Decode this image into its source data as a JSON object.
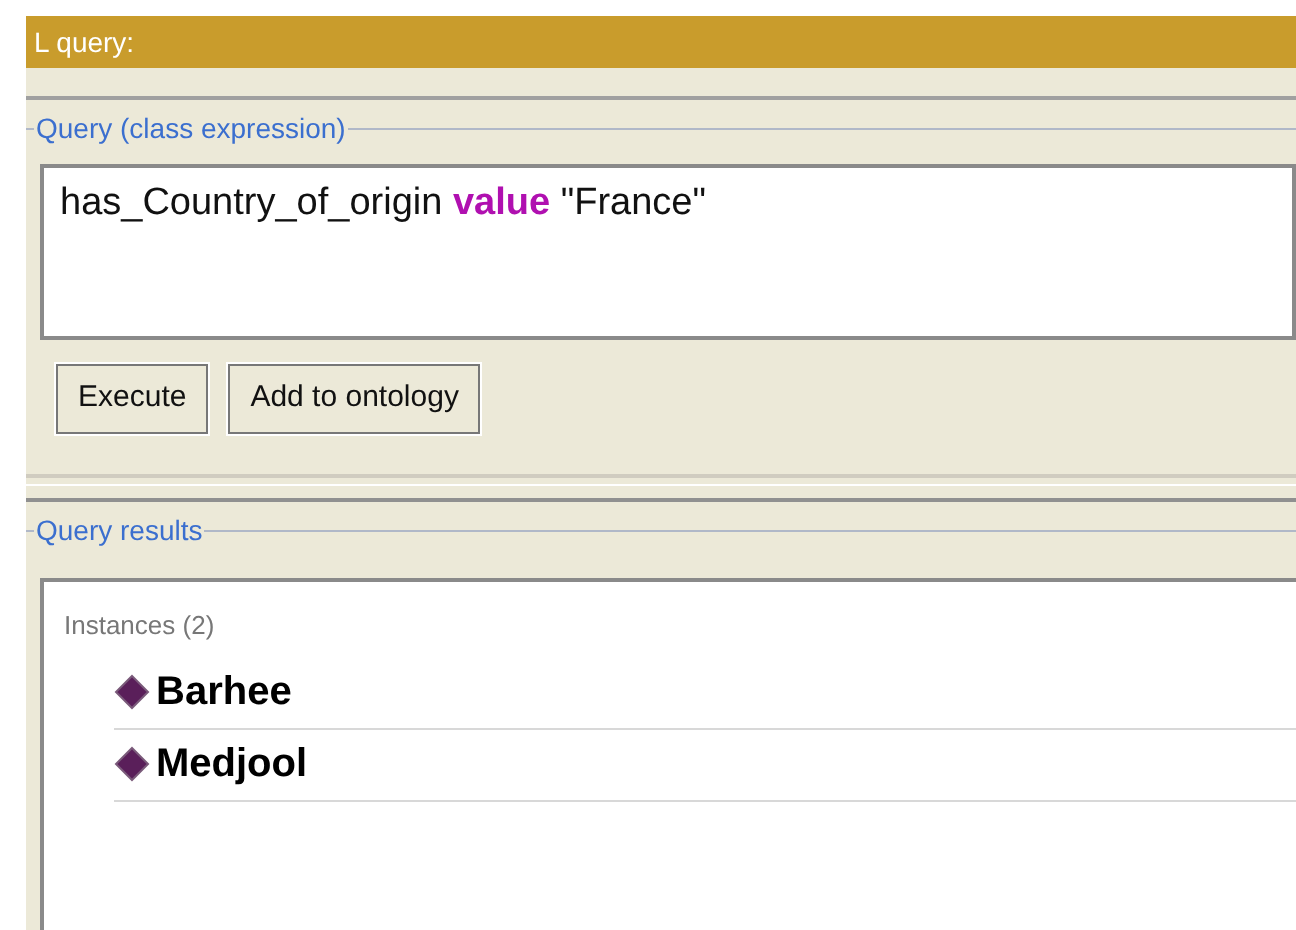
{
  "view_title": "L query:",
  "query": {
    "legend": "Query (class expression)",
    "value": "has_Country_of_origin **value** \"France\""
  },
  "buttons": [
    "Execute",
    "Add to ontology"
  ],
  "results": {
    "legend": "Query results",
    "heading": "Instances (2)",
    "items": [
      {
        "label": "Barhee"
      },
      {
        "label": "Medjool"
      }
    ]
  }
}
